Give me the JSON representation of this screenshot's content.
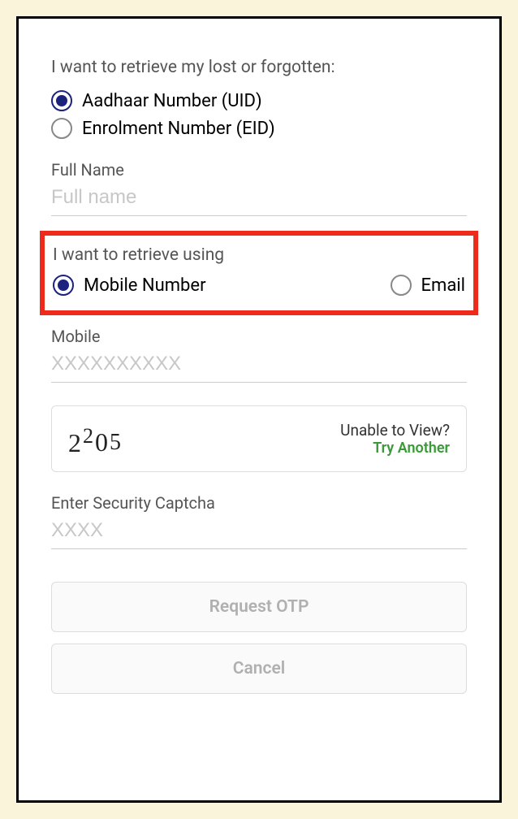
{
  "headings": {
    "retrieve_type": "I want to retrieve my lost or forgotten:",
    "retrieve_using": "I want to retrieve using"
  },
  "radios": {
    "uid": "Aadhaar Number (UID)",
    "eid": "Enrolment Number (EID)",
    "mobile": "Mobile Number",
    "email": "Email"
  },
  "labels": {
    "full_name": "Full Name",
    "mobile": "Mobile",
    "captcha": "Enter Security Captcha"
  },
  "placeholders": {
    "full_name": "Full name",
    "mobile": "XXXXXXXXXX",
    "captcha": "XXXX"
  },
  "captcha": {
    "d1": "2",
    "d2": "2",
    "d3": "0",
    "d4": "5",
    "unable": "Unable to View?",
    "try_another": "Try Another"
  },
  "buttons": {
    "request_otp": "Request OTP",
    "cancel": "Cancel"
  }
}
